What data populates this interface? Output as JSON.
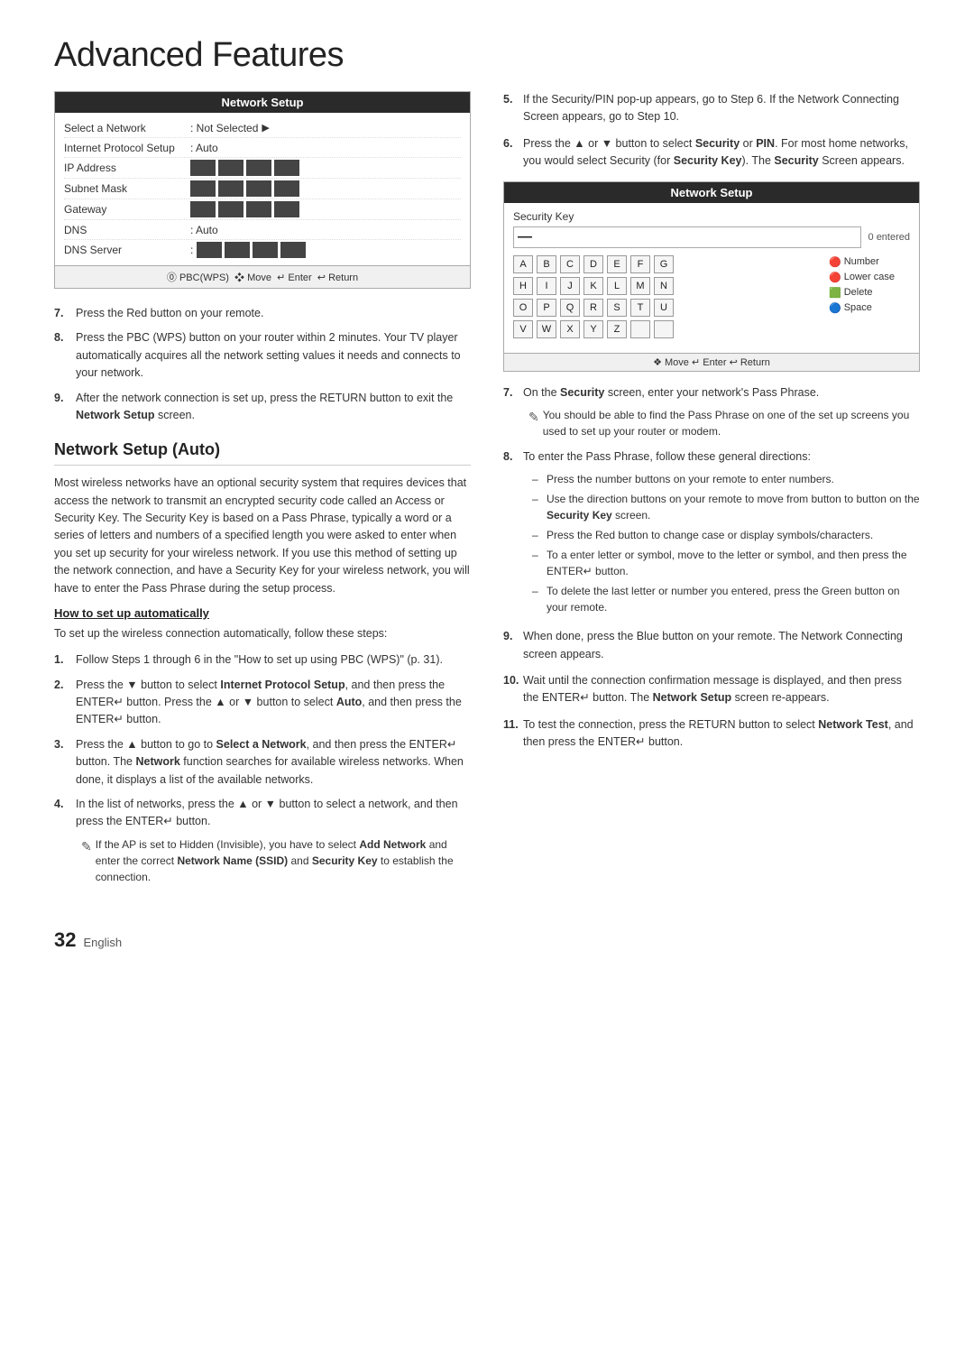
{
  "page": {
    "title": "Advanced Features",
    "page_number": "32",
    "page_lang": "English"
  },
  "network_setup_box": {
    "title": "Network Setup",
    "rows": [
      {
        "label": "Select a Network",
        "value": "Not Selected",
        "has_arrow": true,
        "has_blocks": false
      },
      {
        "label": "Internet Protocol Setup",
        "value": ": Auto",
        "has_arrow": false,
        "has_blocks": false
      },
      {
        "label": "IP Address",
        "value": "",
        "has_arrow": false,
        "has_blocks": true
      },
      {
        "label": "Subnet Mask",
        "value": "",
        "has_arrow": false,
        "has_blocks": true
      },
      {
        "label": "Gateway",
        "value": "",
        "has_arrow": false,
        "has_blocks": true
      },
      {
        "label": "DNS",
        "value": ": Auto",
        "has_arrow": false,
        "has_blocks": false
      },
      {
        "label": "DNS Server",
        "value": ":",
        "has_arrow": false,
        "has_blocks": true
      }
    ],
    "footer": "⓪ PBC(WPS)  ❖ Move  ↵ Enter  ↩ Return"
  },
  "left_steps_intro": {
    "step7": "Press the Red button on your remote.",
    "step8": "Press the PBC (WPS) button on your router within 2 minutes. Your TV player automatically acquires all the network setting values it needs and connects to your network.",
    "step9": "After the network connection is set up, press the RETURN button to exit the Network Setup screen."
  },
  "section": {
    "heading": "Network Setup (Auto)",
    "body": "Most wireless networks have an optional security system that requires devices that access the network to transmit an encrypted security code called an Access or Security Key. The Security Key is based on a Pass Phrase, typically a word or a series of letters and numbers of a specified length you were asked to enter when you set up security for your wireless network. If you use this method of setting up the network connection, and have a Security Key for your wireless network, you will have to enter the Pass Phrase during the setup process.",
    "subsection_heading": "How to set up automatically",
    "subsection_intro": "To set up the wireless connection automatically, follow these steps:",
    "steps": [
      {
        "num": "1.",
        "text": "Follow Steps 1 through 6 in the \"How to set up using PBC (WPS)\" (p. 31)."
      },
      {
        "num": "2.",
        "text": "Press the ▼ button to select Internet Protocol Setup, and then press the ENTER↵ button. Press the ▲ or ▼ button to select Auto, and then press the ENTER↵ button."
      },
      {
        "num": "3.",
        "text": "Press the ▲ button to go to Select a Network, and then press the ENTER↵ button. The Network function searches for available wireless networks. When done, it displays a list of the available networks."
      },
      {
        "num": "4.",
        "text": "In the list of networks, press the ▲ or ▼ button to select a network, and then press the ENTER↵ button.",
        "note": "If the AP is set to Hidden (Invisible), you have to select Add Network and enter the correct Network Name (SSID) and Security Key to establish the connection."
      }
    ]
  },
  "right_col": {
    "step5": "If the Security/PIN pop-up appears, go to Step 6. If the Network Connecting Screen appears, go to Step 10.",
    "step6": "Press the ▲ or ▼ button to select Security or PIN. For most home networks, you would select Security (for Security Key). The Security Screen appears.",
    "security_box": {
      "title": "Network Setup",
      "key_label": "Security Key",
      "input_cursor": "—",
      "entered_text": "0 entered",
      "keyboard_rows": [
        [
          "A",
          "B",
          "C",
          "D",
          "E",
          "F",
          "G"
        ],
        [
          "H",
          "I",
          "J",
          "K",
          "L",
          "M",
          "N"
        ],
        [
          "O",
          "P",
          "Q",
          "R",
          "S",
          "T",
          "U"
        ],
        [
          "V",
          "W",
          "X",
          "Y",
          "Z",
          "",
          ""
        ]
      ],
      "func_keys": [
        {
          "icon": "🔴",
          "label": "Number"
        },
        {
          "icon": "🔴",
          "label": "Lower case"
        },
        {
          "icon": "🟩",
          "label": "Delete"
        },
        {
          "icon": "🔵",
          "label": "Space"
        }
      ],
      "footer": "❖ Move  ↵ Enter  ↩ Return"
    },
    "step7_right": "On the Security screen, enter your network's Pass Phrase.",
    "step7_note": "You should be able to find the Pass Phrase on one of the set up screens you used to set up your router or modem.",
    "step8_right": "To enter the Pass Phrase, follow these general directions:",
    "step8_sub": [
      "Press the number buttons on your remote to enter numbers.",
      "Use the direction buttons on your remote to move from button to button on the Security Key screen.",
      "Press the Red button to change case or display symbols/characters.",
      "To a enter letter or symbol, move to the letter or symbol, and then press the ENTER↵ button.",
      "To delete the last letter or number you entered, press the Green button on your remote."
    ],
    "step9_right": "When done, press the Blue button on your remote. The Network Connecting screen appears.",
    "step10_right": "Wait until the connection confirmation message is displayed, and then press the ENTER↵ button. The Network Setup screen re-appears.",
    "step11_right": "To test the connection, press the RETURN button to select Network Test, and then press the ENTER↵ button."
  }
}
